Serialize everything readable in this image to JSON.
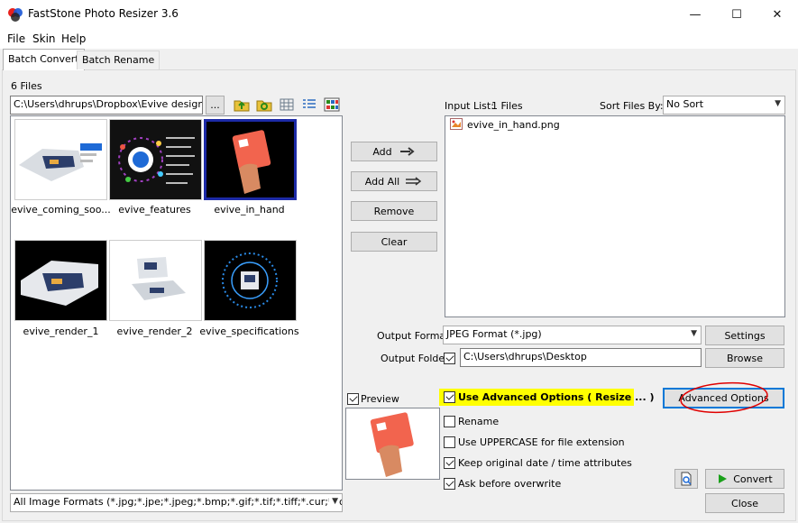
{
  "window": {
    "title": "FastStone Photo Resizer 3.6",
    "minimize": "—",
    "maximize": "☐",
    "close": "✕"
  },
  "menu": [
    "File",
    "Skin",
    "Help"
  ],
  "tabs": [
    "Batch Convert",
    "Batch Rename"
  ],
  "file_count": "6 Files",
  "path": {
    "value": "C:\\Users\\dhrups\\Dropbox\\Evive design\\Pre",
    "browse_label": "..."
  },
  "thumbnails": [
    {
      "label": "evive_coming_soo..."
    },
    {
      "label": "evive_features"
    },
    {
      "label": "evive_in_hand"
    },
    {
      "label": "evive_render_1"
    },
    {
      "label": "evive_render_2"
    },
    {
      "label": "evive_specifications"
    }
  ],
  "filter": {
    "value": "All Image Formats (*.jpg;*.jpe;*.jpeg;*.bmp;*.gif;*.tif;*.tiff;*.cur;*.ico"
  },
  "buttons": {
    "add": "Add",
    "add_all": "Add All",
    "remove": "Remove",
    "clear": "Clear"
  },
  "input_list": {
    "label": "Input List:",
    "count": "1 Files",
    "sort_label": "Sort Files By:",
    "sort_value": "No Sort",
    "items": [
      "evive_in_hand.png"
    ]
  },
  "output": {
    "format_label": "Output Format:",
    "format_value": "JPEG Format (*.jpg)",
    "settings": "Settings",
    "folder_label": "Output Folder:",
    "folder_value": "C:\\Users\\dhrups\\Desktop",
    "browse": "Browse"
  },
  "preview": {
    "label": "Preview"
  },
  "options": {
    "advanced": "Use Advanced Options ( Resize ... )",
    "advanced_button": "Advanced Options",
    "rename": "Rename",
    "uppercase": "Use UPPERCASE for file extension",
    "keep_date": "Keep original date / time attributes",
    "ask_overwrite": "Ask before overwrite"
  },
  "actions": {
    "convert": "Convert",
    "close": "Close"
  },
  "colors": {
    "highlight": "#ffff00",
    "annotation": "#e00000",
    "focus": "#0078d7",
    "selection": "#1c2aa6"
  }
}
